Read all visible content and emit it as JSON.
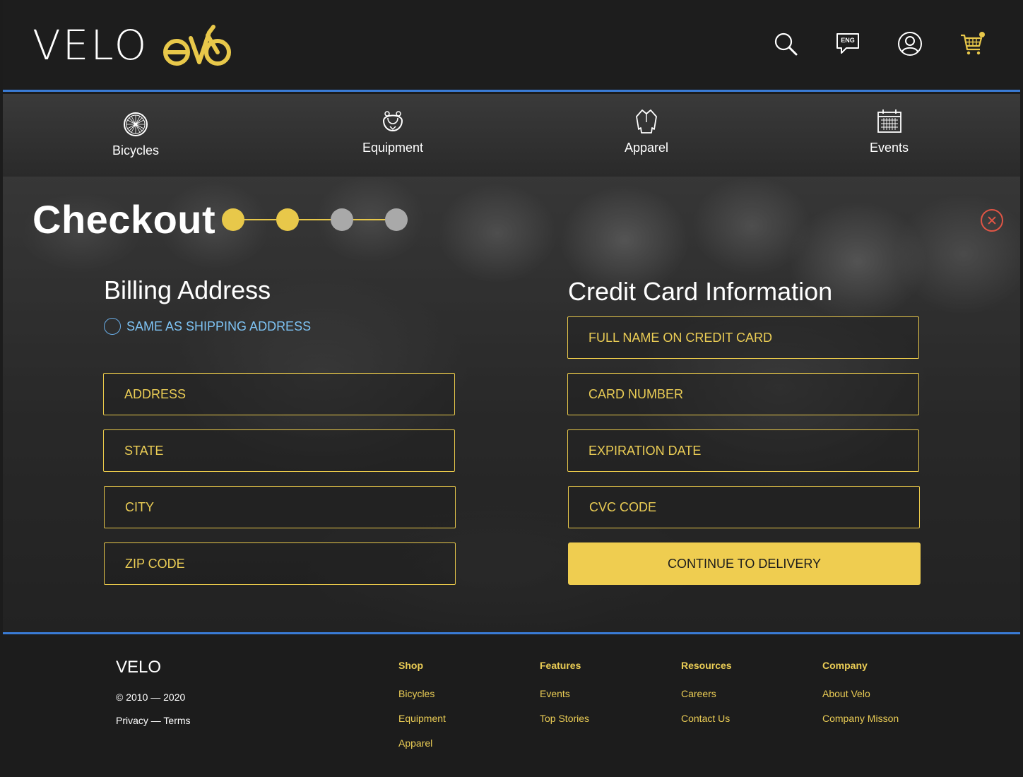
{
  "header": {
    "brand": "VELO",
    "language_badge": "ENG",
    "icons": [
      "search-icon",
      "language-icon",
      "account-icon",
      "cart-icon"
    ],
    "accent_color": "#e8c84a",
    "divider_color": "#3a7bd5"
  },
  "nav": {
    "items": [
      {
        "label": "Bicycles",
        "icon": "wheel-icon"
      },
      {
        "label": "Equipment",
        "icon": "helmet-icon"
      },
      {
        "label": "Apparel",
        "icon": "jersey-icon"
      },
      {
        "label": "Events",
        "icon": "calendar-icon"
      }
    ]
  },
  "checkout": {
    "title": "Checkout",
    "steps_total": 4,
    "steps_completed": 2,
    "step_colors": {
      "done": "#e8c84a",
      "pending": "#a9a9a9"
    }
  },
  "billing": {
    "title": "Billing Address",
    "same_as_shipping": "SAME AS SHIPPING ADDRESS",
    "fields": {
      "address": "ADDRESS",
      "state": "STATE",
      "city": "CITY",
      "zip": "ZIP CODE"
    }
  },
  "credit_card": {
    "title": "Credit Card Information",
    "fields": {
      "name": "FULL NAME ON CREDIT CARD",
      "number": "CARD NUMBER",
      "expiration": "EXPIRATION DATE",
      "cvc": "CVC CODE"
    },
    "continue_button": "CONTINUE TO DELIVERY"
  },
  "footer": {
    "brand": "VELO",
    "copyright": "© 2010 — 2020",
    "legal": "Privacy — Terms",
    "columns": [
      {
        "heading": "Shop",
        "links": [
          "Bicycles",
          "Equipment",
          "Apparel"
        ]
      },
      {
        "heading": "Features",
        "links": [
          "Events",
          "Top Stories"
        ]
      },
      {
        "heading": "Resources",
        "links": [
          "Careers",
          "Contact Us"
        ]
      },
      {
        "heading": "Company",
        "links": [
          "About Velo",
          "Company Misson"
        ]
      }
    ]
  }
}
